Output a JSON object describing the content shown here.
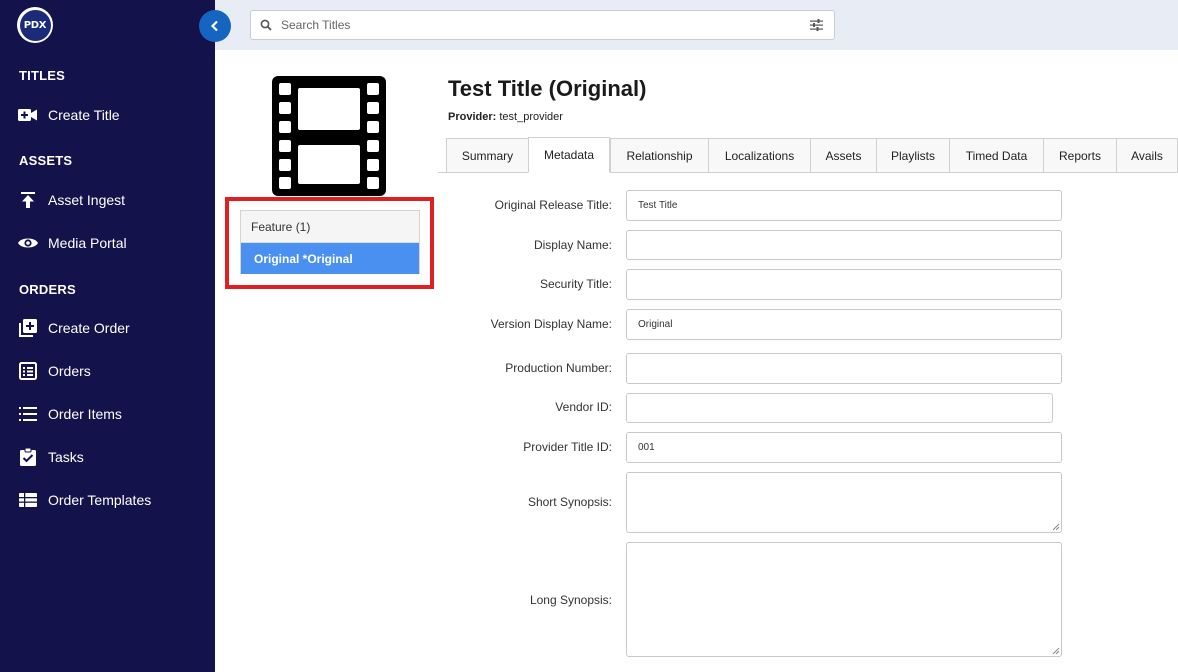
{
  "sidebar": {
    "logo_text": "PDX",
    "sections": {
      "titles": "TITLES",
      "assets": "ASSETS",
      "orders": "ORDERS"
    },
    "items": {
      "create_title": "Create Title",
      "asset_ingest": "Asset Ingest",
      "media_portal": "Media Portal",
      "create_order": "Create Order",
      "orders": "Orders",
      "order_items": "Order Items",
      "tasks": "Tasks",
      "order_templates": "Order Templates"
    },
    "icons": {
      "create_title": "video-plus-icon",
      "asset_ingest": "upload-icon",
      "media_portal": "eye-icon",
      "create_order": "add-box-icon",
      "orders": "list-box-icon",
      "order_items": "list-icon",
      "tasks": "clipboard-check-icon",
      "order_templates": "table-icon"
    }
  },
  "search": {
    "placeholder": "Search Titles"
  },
  "title": {
    "name": "Test Title (Original)",
    "provider_label": "Provider:",
    "provider_value": "test_provider"
  },
  "versions": {
    "header": "Feature (1)",
    "selected": "Original *Original"
  },
  "tabs": {
    "summary": "Summary",
    "metadata": "Metadata",
    "relationship": "Relationship",
    "localizations": "Localizations",
    "assets": "Assets",
    "playlists": "Playlists",
    "timed_data": "Timed Data",
    "reports": "Reports",
    "avails": "Avails"
  },
  "form": {
    "original_release_title": {
      "label": "Original Release Title:",
      "value": "Test Title"
    },
    "display_name": {
      "label": "Display Name:",
      "value": ""
    },
    "security_title": {
      "label": "Security Title:",
      "value": ""
    },
    "version_display_name": {
      "label": "Version Display Name:",
      "value": "Original"
    },
    "production_number": {
      "label": "Production Number:",
      "value": ""
    },
    "vendor_id": {
      "label": "Vendor ID:",
      "value": ""
    },
    "provider_title_id": {
      "label": "Provider Title ID:",
      "value": "001"
    },
    "short_synopsis": {
      "label": "Short Synopsis:",
      "value": ""
    },
    "long_synopsis": {
      "label": "Long Synopsis:",
      "value": ""
    }
  },
  "colors": {
    "sidebar_bg": "#13124a",
    "accent_blue": "#1565c0",
    "selected_item": "#4a90f0",
    "highlight_red": "#e02020"
  }
}
